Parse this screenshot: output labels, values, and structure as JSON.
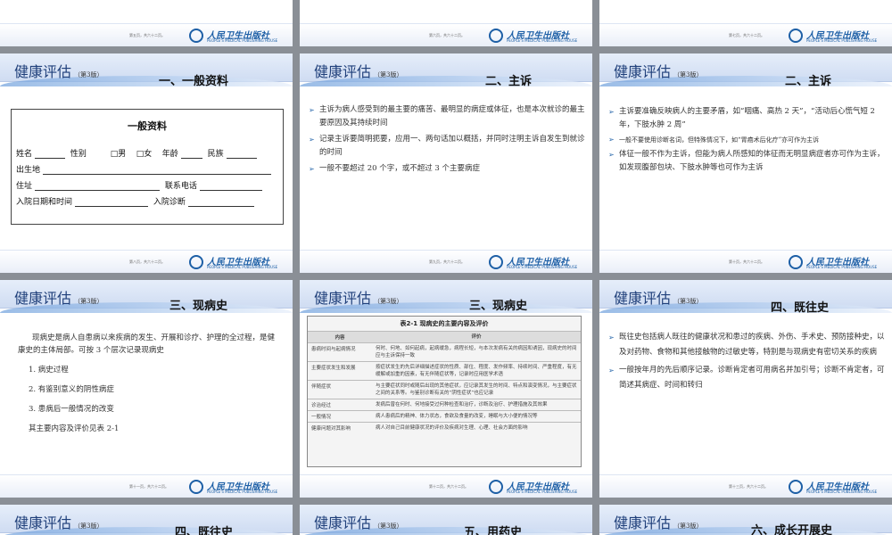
{
  "brand": {
    "title": "健康评估",
    "edition": "（第3版）"
  },
  "publisher": {
    "cn": "人民卫生出版社",
    "en": "PEOPLE'S MEDICAL PUBLISHING HOUSE"
  },
  "pages": [
    "第五页，共六十二页。",
    "第六页，共六十二页。",
    "第七页，共六十二页。",
    "第八页，共六十二页。",
    "第九页，共六十二页。",
    "第十页，共六十二页。",
    "第十一页，共六十二页。",
    "第十二页，共六十二页。",
    "第十三页，共六十二页。"
  ],
  "slides": {
    "s1": {
      "section": "一、一般资料",
      "form_title": "一般资料",
      "row1": {
        "name": "姓名",
        "sex": "性别",
        "male": "□男",
        "female": "□女",
        "age": "年龄",
        "ethnic": "民族"
      },
      "row2": {
        "birthplace": "出生地"
      },
      "row3": {
        "address": "住址",
        "phone": "联系电话"
      },
      "row4": {
        "admit_time": "入院日期和时间",
        "admit_dx": "入院诊断"
      }
    },
    "s2": {
      "section": "二、主诉",
      "bullets": [
        "主诉为病人感受到的最主要的痛苦、最明显的病症或体征，也是本次就诊的最主要原因及其持续时间",
        "记录主诉要简明扼要，应用一、两句话加以概括，并同时注明主诉自发生到就诊的时间",
        "一般不要超过 20 个字，或不超过 3 个主要病症"
      ]
    },
    "s3": {
      "section": "二、主诉",
      "bullets": [
        "主诉要准确反映病人的主要矛盾，如“咽痛、高热 2 天”，“活动后心慌气短 2 年，下肢水肿 2 周”",
        "一般不要使用诊断名词，但特殊情况下，如“胃癌术后化疗”亦可作为主诉",
        "体征一般不作为主诉，但能为病人所感知的体征而无明显病症者亦可作为主诉，如发现腹部包块、下肢水肿等也可作为主诉"
      ]
    },
    "s4": {
      "section": "三、现病史",
      "intro": "现病史是病人自患病以来疾病的发生、开展和诊疗、护理的全过程，是健康史的主体局部。可按 3 个层次记录现病史",
      "items": [
        "1. 病史过程",
        "2. 有鉴别意义的阴性病症",
        "3. 患病后一般情况的改变"
      ],
      "note": "其主要内容及评价见表 2-1"
    },
    "s5": {
      "section": "三、现病史",
      "table_caption": "表2-1  现病史的主要内容及评价",
      "table_head": [
        "内容",
        "评价"
      ],
      "rows": [
        [
          "患病时间与起病情况",
          "何时、何地、如何起病，起病缓急，病程长短，与本次发病有关的病因和诱因，现病史的时间应与主诉保持一致"
        ],
        [
          "主要症状发生和发展",
          "按症状发生的先后详细描述症状的性质、部位、程度、发作频率、持续时间、严重程度，有无缓解或加重的因素，有无伴随症状等，记录时应用医学术语"
        ],
        [
          "伴随症状",
          "与主要症状同时或随后出现的其他症状，应记录其发生的时间、特点和演变情况，与主要症状之间的关系等。与鉴别诊断有关的“阴性症状”也应记录"
        ],
        [
          "诊治经过",
          "发病后曾在何时、何地接受过何种检查和治疗，诊断及治疗、护理措施及其效果"
        ],
        [
          "一般情况",
          "病人患病后的精神、体力状态，食欲及食量的改变，睡眠与大小便的情况等"
        ],
        [
          "健康问题对其影响",
          "病人对自己目前健康状况的评价及疾病对生理、心理、社会方面的影响"
        ]
      ]
    },
    "s6": {
      "section": "四、既往史",
      "bullets": [
        "既往史包括病人既往的健康状况和患过的疾病、外伤、手术史、预防接种史，以及对药物、食物和其他接触物的过敏史等，特别是与现病史有密切关系的疾病",
        "一般按年月的先后顺序记录。诊断肯定者可用病名并加引号；诊断不肯定者，可简述其病症、时间和转归"
      ]
    },
    "s7": {
      "section": "四、既往史"
    },
    "s8": {
      "section": "五、用药史"
    },
    "s9": {
      "section": "六、成长开展史"
    }
  }
}
